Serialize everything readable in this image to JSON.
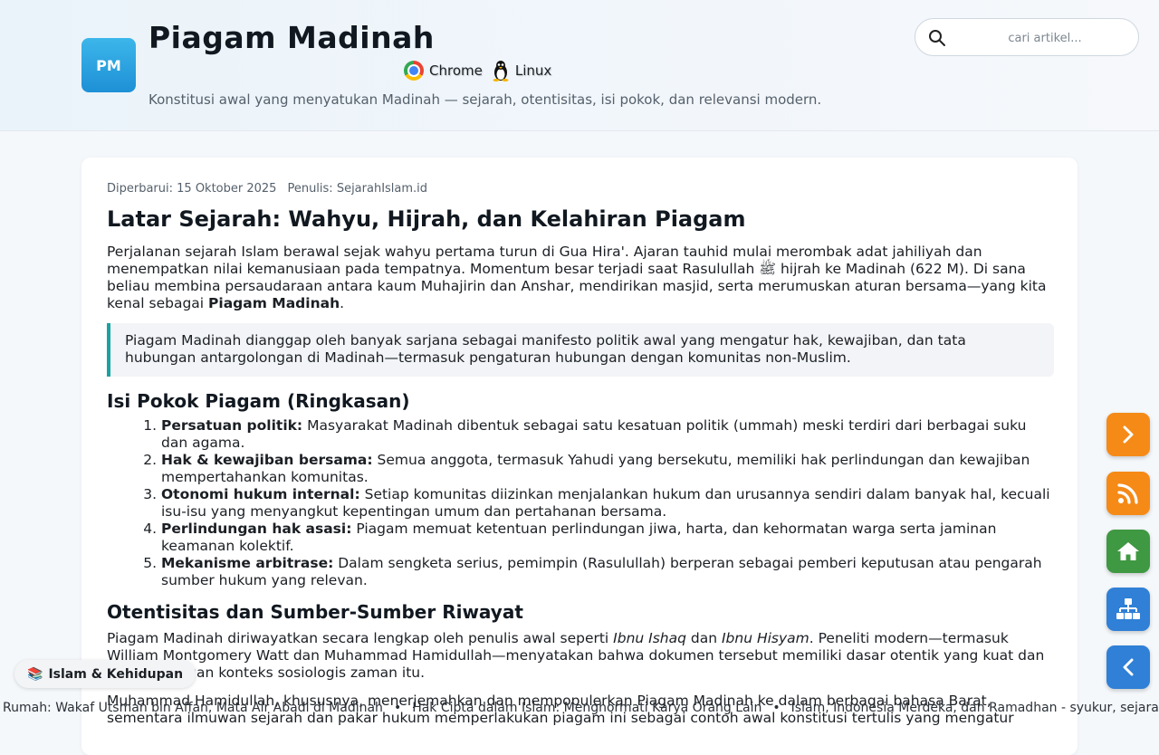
{
  "header": {
    "logo_text": "PM",
    "title": "Piagam Madinah",
    "badges": [
      {
        "label": "Chrome",
        "icon": "chrome-icon"
      },
      {
        "label": "Linux",
        "icon": "linux-tux-icon"
      }
    ],
    "tagline": "Konstitusi awal yang menyatukan Madinah — sejarah, otentisitas, isi pokok, dan relevansi modern."
  },
  "search": {
    "placeholder": "cari artikel...",
    "value": "",
    "icon": "search-icon"
  },
  "article": {
    "updated": "Diperbarui: 15 Oktober 2025",
    "author": "Penulis: SejarahIslam.id",
    "heading": "Latar Sejarah: Wahyu, Hijrah, dan Kelahiran Piagam",
    "intro_before": "Perjalanan sejarah Islam berawal sejak wahyu pertama turun di Gua Hira'. Ajaran tauhid mulai merombak adat jahiliyah dan menempatkan nilai kemanusiaan pada tempatnya. Momentum besar terjadi saat Rasulullah ",
    "intro_glyph": "ﷺ",
    "intro_middle": " hijrah ke Madinah (622 M). Di sana beliau membina persaudaraan antara kaum Muhajirin dan Anshar, mendirikan masjid, serta merumuskan aturan bersama—yang kita kenal sebagai ",
    "intro_bold": "Piagam Madinah",
    "intro_end": ".",
    "quote": "Piagam Madinah dianggap oleh banyak sarjana sebagai manifesto politik awal yang mengatur hak, kewajiban, dan tata hubungan antargolongan di Madinah—termasuk pengaturan hubungan dengan komunitas non-Muslim.",
    "section1_title": "Isi Pokok Piagam (Ringkasan)",
    "points": [
      {
        "term": "Persatuan politik:",
        "text": " Masyarakat Madinah dibentuk sebagai satu kesatuan politik (ummah) meski terdiri dari berbagai suku dan agama."
      },
      {
        "term": "Hak & kewajiban bersama:",
        "text": " Semua anggota, termasuk Yahudi yang bersekutu, memiliki hak perlindungan dan kewajiban mempertahankan komunitas."
      },
      {
        "term": "Otonomi hukum internal:",
        "text": " Setiap komunitas diizinkan menjalankan hukum dan urusannya sendiri dalam banyak hal, kecuali isu-isu yang menyangkut kepentingan umum dan pertahanan bersama."
      },
      {
        "term": "Perlindungan hak asasi:",
        "text": " Piagam memuat ketentuan perlindungan jiwa, harta, dan kehormatan warga serta jaminan keamanan kolektif."
      },
      {
        "term": "Mekanisme arbitrase:",
        "text": " Dalam sengketa serius, pemimpin (Rasulullah) berperan sebagai pemberi keputusan atau pengarah sumber hukum yang relevan."
      }
    ],
    "section2_title": "Otentisitas dan Sumber-Sumber Riwayat",
    "p2_a": "Piagam Madinah diriwayatkan secara lengkap oleh penulis awal seperti ",
    "p2_i1": "Ibnu Ishaq",
    "p2_b": " dan ",
    "p2_i2": "Ibnu Hisyam",
    "p2_c": ". Peneliti modern—termasuk William Montgomery Watt dan Muhammad Hamidullah—menyatakan bahwa dokumen tersebut memiliki dasar otentik yang kuat dan sejalan dengan konteks sosiologis zaman itu.",
    "p3": "Muhammad Hamidullah, khususnya, menerjemahkan dan mempopulerkan Piagam Madinah ke dalam berbagai bahasa Barat, sementara ilmuwan sejarah dan pakar hukum memperlakukan piagam ini sebagai contoh awal konstitusi tertulis yang mengatur"
  },
  "tag_pill": {
    "icon": "books-icon",
    "label": "Islam & Kehidupan"
  },
  "ticker": [
    "Rumah: Wakaf Utsman bin Affan, Mata Air Abadi di Madinah",
    "Hak Cipta dalam Islam: Menghormati Karya Orang Lain",
    "Islam, Indonesia Merdeka, dan Ramadhan - syukur, sejarah"
  ],
  "floating_buttons": [
    {
      "name": "next-button",
      "icon": "chevron-right-icon",
      "color": "#f58a17"
    },
    {
      "name": "rss-button",
      "icon": "rss-icon",
      "color": "#f58a17"
    },
    {
      "name": "home-button",
      "icon": "home-icon",
      "color": "#3f9842"
    },
    {
      "name": "sitemap-button",
      "icon": "sitemap-icon",
      "color": "#2f80d6"
    },
    {
      "name": "back-button",
      "icon": "chevron-left-icon",
      "color": "#2f80d6"
    }
  ]
}
